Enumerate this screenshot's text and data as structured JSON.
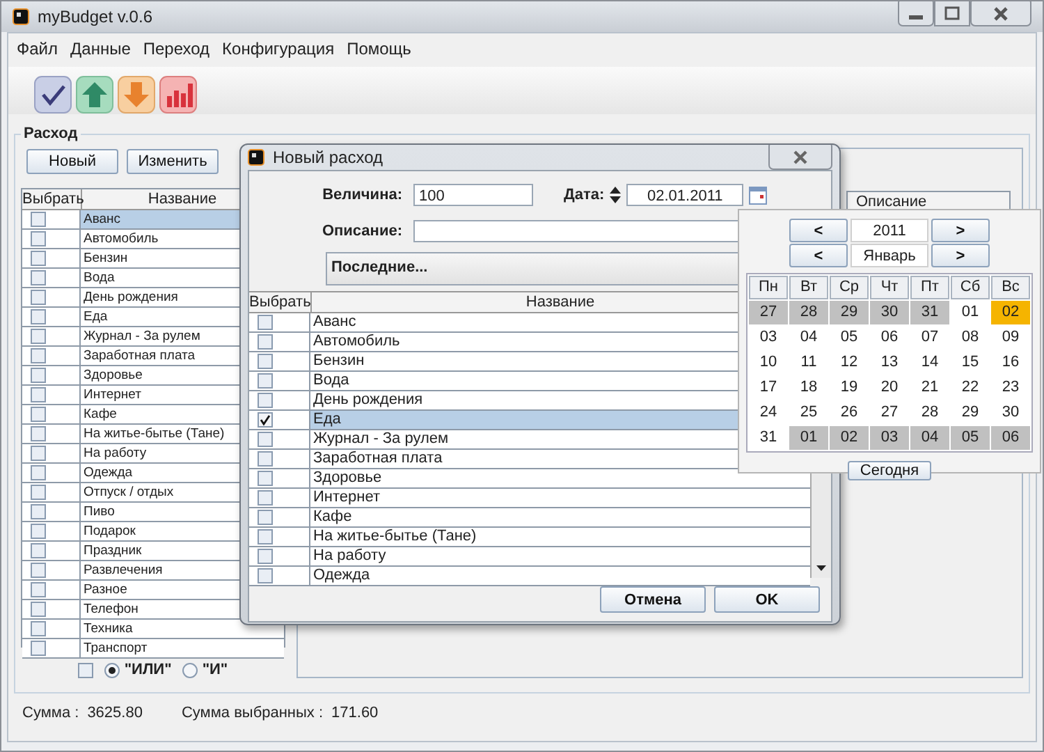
{
  "window": {
    "title": "myBudget v.0.6"
  },
  "menu": [
    "Файл",
    "Данные",
    "Переход",
    "Конфигурация",
    "Помощь"
  ],
  "expense_panel": {
    "title": "Расход",
    "buttons": [
      "Новый",
      "Изменить"
    ],
    "table": {
      "columns": [
        "Выбрать",
        "Название"
      ],
      "rows": [
        {
          "name": "Аванс",
          "checked": false,
          "selected": true
        },
        {
          "name": "Автомобиль",
          "checked": false,
          "selected": false
        },
        {
          "name": "Бензин",
          "checked": false,
          "selected": false
        },
        {
          "name": "Вода",
          "checked": false,
          "selected": false
        },
        {
          "name": "День рождения",
          "checked": false,
          "selected": false
        },
        {
          "name": "Еда",
          "checked": false,
          "selected": false
        },
        {
          "name": "Журнал - За рулем",
          "checked": false,
          "selected": false
        },
        {
          "name": "Заработная плата",
          "checked": false,
          "selected": false
        },
        {
          "name": "Здоровье",
          "checked": false,
          "selected": false
        },
        {
          "name": "Интернет",
          "checked": false,
          "selected": false
        },
        {
          "name": "Кафе",
          "checked": false,
          "selected": false
        },
        {
          "name": "На житье-бытье (Тане)",
          "checked": false,
          "selected": false
        },
        {
          "name": "На работу",
          "checked": false,
          "selected": false
        },
        {
          "name": "Одежда",
          "checked": false,
          "selected": false
        },
        {
          "name": "Отпуск / отдых",
          "checked": false,
          "selected": false
        },
        {
          "name": "Пиво",
          "checked": false,
          "selected": false
        },
        {
          "name": "Подарок",
          "checked": false,
          "selected": false
        },
        {
          "name": "Праздник",
          "checked": false,
          "selected": false
        },
        {
          "name": "Развлечения",
          "checked": false,
          "selected": false
        },
        {
          "name": "Разное",
          "checked": false,
          "selected": false
        },
        {
          "name": "Телефон",
          "checked": false,
          "selected": false
        },
        {
          "name": "Техника",
          "checked": false,
          "selected": false
        },
        {
          "name": "Транспорт",
          "checked": false,
          "selected": false
        }
      ]
    },
    "filter": {
      "checked": false,
      "options": [
        {
          "label": "\"ИЛИ\"",
          "selected": true
        },
        {
          "label": "\"И\"",
          "selected": false
        }
      ]
    }
  },
  "details_table": {
    "columns": [
      "Описание"
    ]
  },
  "status_bar": {
    "total_label": "Сумма :",
    "total": "3625.80",
    "selected_label": "Сумма выбранных :",
    "selected_total": "171.60"
  },
  "dialog": {
    "title": "Новый расход",
    "amount": {
      "label": "Величина:",
      "value": "100"
    },
    "date": {
      "label": "Дата:",
      "value": "02.01.2011"
    },
    "description": {
      "label": "Описание:"
    },
    "recent": {
      "value": "Последние..."
    },
    "table": {
      "columns": [
        "Выбрать",
        "Название"
      ],
      "rows": [
        {
          "name": "Аванс",
          "checked": false,
          "selected": false
        },
        {
          "name": "Автомобиль",
          "checked": false,
          "selected": false
        },
        {
          "name": "Бензин",
          "checked": false,
          "selected": false
        },
        {
          "name": "Вода",
          "checked": false,
          "selected": false
        },
        {
          "name": "День рождения",
          "checked": false,
          "selected": false
        },
        {
          "name": "Еда",
          "checked": true,
          "selected": true
        },
        {
          "name": "Журнал - За рулем",
          "checked": false,
          "selected": false
        },
        {
          "name": "Заработная плата",
          "checked": false,
          "selected": false
        },
        {
          "name": "Здоровье",
          "checked": false,
          "selected": false
        },
        {
          "name": "Интернет",
          "checked": false,
          "selected": false
        },
        {
          "name": "Кафе",
          "checked": false,
          "selected": false
        },
        {
          "name": "На житье-бытье (Тане)",
          "checked": false,
          "selected": false
        },
        {
          "name": "На работу",
          "checked": false,
          "selected": false
        },
        {
          "name": "Одежда",
          "checked": false,
          "selected": false
        }
      ]
    },
    "buttons": [
      "Отмена",
      "OK"
    ]
  },
  "calendar": {
    "year_nav": {
      "prev": "<",
      "value": "2011",
      "next": ">"
    },
    "month_nav": {
      "prev": "<",
      "value": "Январь",
      "next": ">"
    },
    "weekdays": [
      "Пн",
      "Вт",
      "Ср",
      "Чт",
      "Пт",
      "Сб",
      "Вс"
    ],
    "days": [
      {
        "label": "27",
        "outside": true,
        "selected": false
      },
      {
        "label": "28",
        "outside": true,
        "selected": false
      },
      {
        "label": "29",
        "outside": true,
        "selected": false
      },
      {
        "label": "30",
        "outside": true,
        "selected": false
      },
      {
        "label": "31",
        "outside": true,
        "selected": false
      },
      {
        "label": "01",
        "outside": false,
        "selected": false
      },
      {
        "label": "02",
        "outside": false,
        "selected": true
      },
      {
        "label": "03",
        "outside": false,
        "selected": false
      },
      {
        "label": "04",
        "outside": false,
        "selected": false
      },
      {
        "label": "05",
        "outside": false,
        "selected": false
      },
      {
        "label": "06",
        "outside": false,
        "selected": false
      },
      {
        "label": "07",
        "outside": false,
        "selected": false
      },
      {
        "label": "08",
        "outside": false,
        "selected": false
      },
      {
        "label": "09",
        "outside": false,
        "selected": false
      },
      {
        "label": "10",
        "outside": false,
        "selected": false
      },
      {
        "label": "11",
        "outside": false,
        "selected": false
      },
      {
        "label": "12",
        "outside": false,
        "selected": false
      },
      {
        "label": "13",
        "outside": false,
        "selected": false
      },
      {
        "label": "14",
        "outside": false,
        "selected": false
      },
      {
        "label": "15",
        "outside": false,
        "selected": false
      },
      {
        "label": "16",
        "outside": false,
        "selected": false
      },
      {
        "label": "17",
        "outside": false,
        "selected": false
      },
      {
        "label": "18",
        "outside": false,
        "selected": false
      },
      {
        "label": "19",
        "outside": false,
        "selected": false
      },
      {
        "label": "20",
        "outside": false,
        "selected": false
      },
      {
        "label": "21",
        "outside": false,
        "selected": false
      },
      {
        "label": "22",
        "outside": false,
        "selected": false
      },
      {
        "label": "23",
        "outside": false,
        "selected": false
      },
      {
        "label": "24",
        "outside": false,
        "selected": false
      },
      {
        "label": "25",
        "outside": false,
        "selected": false
      },
      {
        "label": "26",
        "outside": false,
        "selected": false
      },
      {
        "label": "27",
        "outside": false,
        "selected": false
      },
      {
        "label": "28",
        "outside": false,
        "selected": false
      },
      {
        "label": "29",
        "outside": false,
        "selected": false
      },
      {
        "label": "30",
        "outside": false,
        "selected": false
      },
      {
        "label": "31",
        "outside": false,
        "selected": false
      },
      {
        "label": "01",
        "outside": true,
        "selected": false
      },
      {
        "label": "02",
        "outside": true,
        "selected": false
      },
      {
        "label": "03",
        "outside": true,
        "selected": false
      },
      {
        "label": "04",
        "outside": true,
        "selected": false
      },
      {
        "label": "05",
        "outside": true,
        "selected": false
      },
      {
        "label": "06",
        "outside": true,
        "selected": false
      }
    ],
    "today_button": "Сегодня"
  }
}
